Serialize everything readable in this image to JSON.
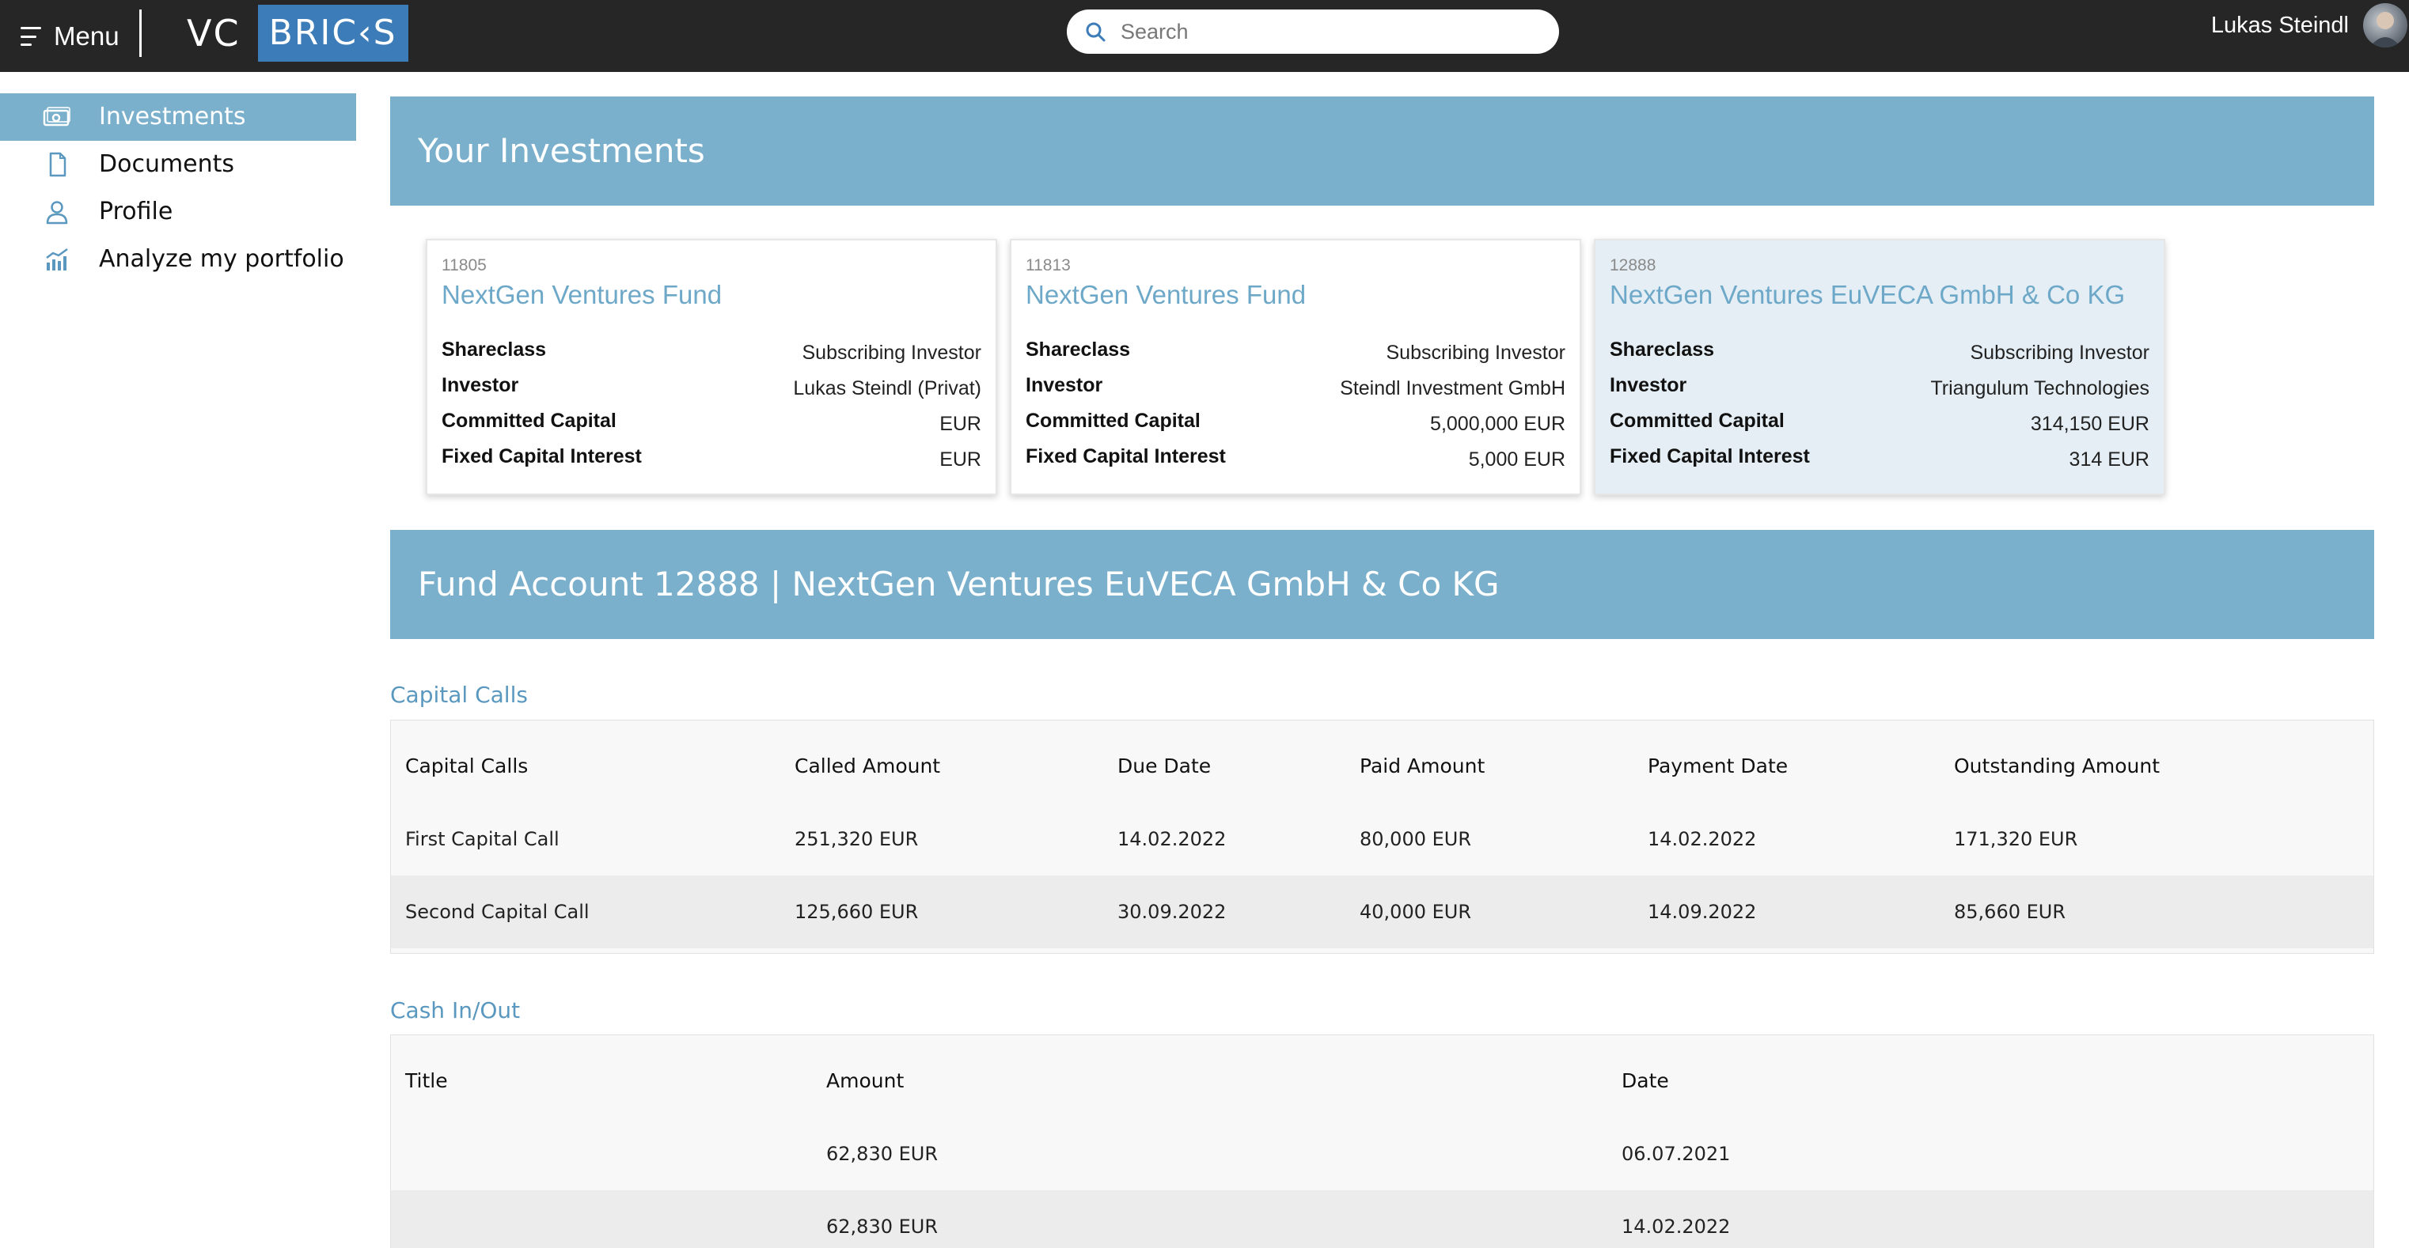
{
  "header": {
    "menu_label": "Menu",
    "logo_vc": "VC",
    "logo_bricks": "BRIC‹S",
    "search_placeholder": "Search",
    "user_name": "Lukas Steindl"
  },
  "sidebar": {
    "items": [
      {
        "label": "Investments",
        "icon": "money-icon",
        "active": true
      },
      {
        "label": "Documents",
        "icon": "document-icon",
        "active": false
      },
      {
        "label": "Profile",
        "icon": "user-icon",
        "active": false
      },
      {
        "label": "Analyze my portfolio",
        "icon": "chart-icon",
        "active": false
      }
    ]
  },
  "investments": {
    "title": "Your Investments",
    "field_labels": {
      "shareclass": "Shareclass",
      "investor": "Investor",
      "committed": "Committed Capital",
      "fixed": "Fixed Capital Interest"
    },
    "cards": [
      {
        "id": "11805",
        "name": "NextGen Ventures Fund",
        "shareclass": "Subscribing Investor",
        "investor": "Lukas Steindl (Privat)",
        "committed": "EUR",
        "fixed": "EUR"
      },
      {
        "id": "11813",
        "name": "NextGen Ventures Fund",
        "shareclass": "Subscribing Investor",
        "investor": "Steindl Investment GmbH",
        "committed": "5,000,000 EUR",
        "fixed": "5,000 EUR"
      },
      {
        "id": "12888",
        "name": "NextGen Ventures EuVECA GmbH & Co KG",
        "shareclass": "Subscribing Investor",
        "investor": "Triangulum Technologies",
        "committed": "314,150 EUR",
        "fixed": "314 EUR"
      }
    ]
  },
  "fund_account": {
    "title": "Fund Account 12888 | NextGen Ventures EuVECA GmbH & Co KG"
  },
  "capital_calls": {
    "heading": "Capital Calls",
    "columns": [
      "Capital Calls",
      "Called Amount",
      "Due Date",
      "Paid Amount",
      "Payment Date",
      "Outstanding Amount"
    ],
    "rows": [
      [
        "First Capital Call",
        "251,320 EUR",
        "14.02.2022",
        "80,000 EUR",
        "14.02.2022",
        "171,320 EUR"
      ],
      [
        "Second Capital Call",
        "125,660 EUR",
        "30.09.2022",
        "40,000 EUR",
        "14.09.2022",
        "85,660 EUR"
      ]
    ]
  },
  "cash_inout": {
    "heading": "Cash In/Out",
    "columns": [
      "Title",
      "Amount",
      "Date"
    ],
    "rows": [
      [
        "",
        "62,830 EUR",
        "06.07.2021"
      ],
      [
        "",
        "62,830 EUR",
        "14.02.2022"
      ]
    ]
  },
  "colors": {
    "topbar": "#262626",
    "accent": "#7ab0cc",
    "logo_box": "#3c7cb8",
    "link_blue": "#6ea8c8"
  }
}
